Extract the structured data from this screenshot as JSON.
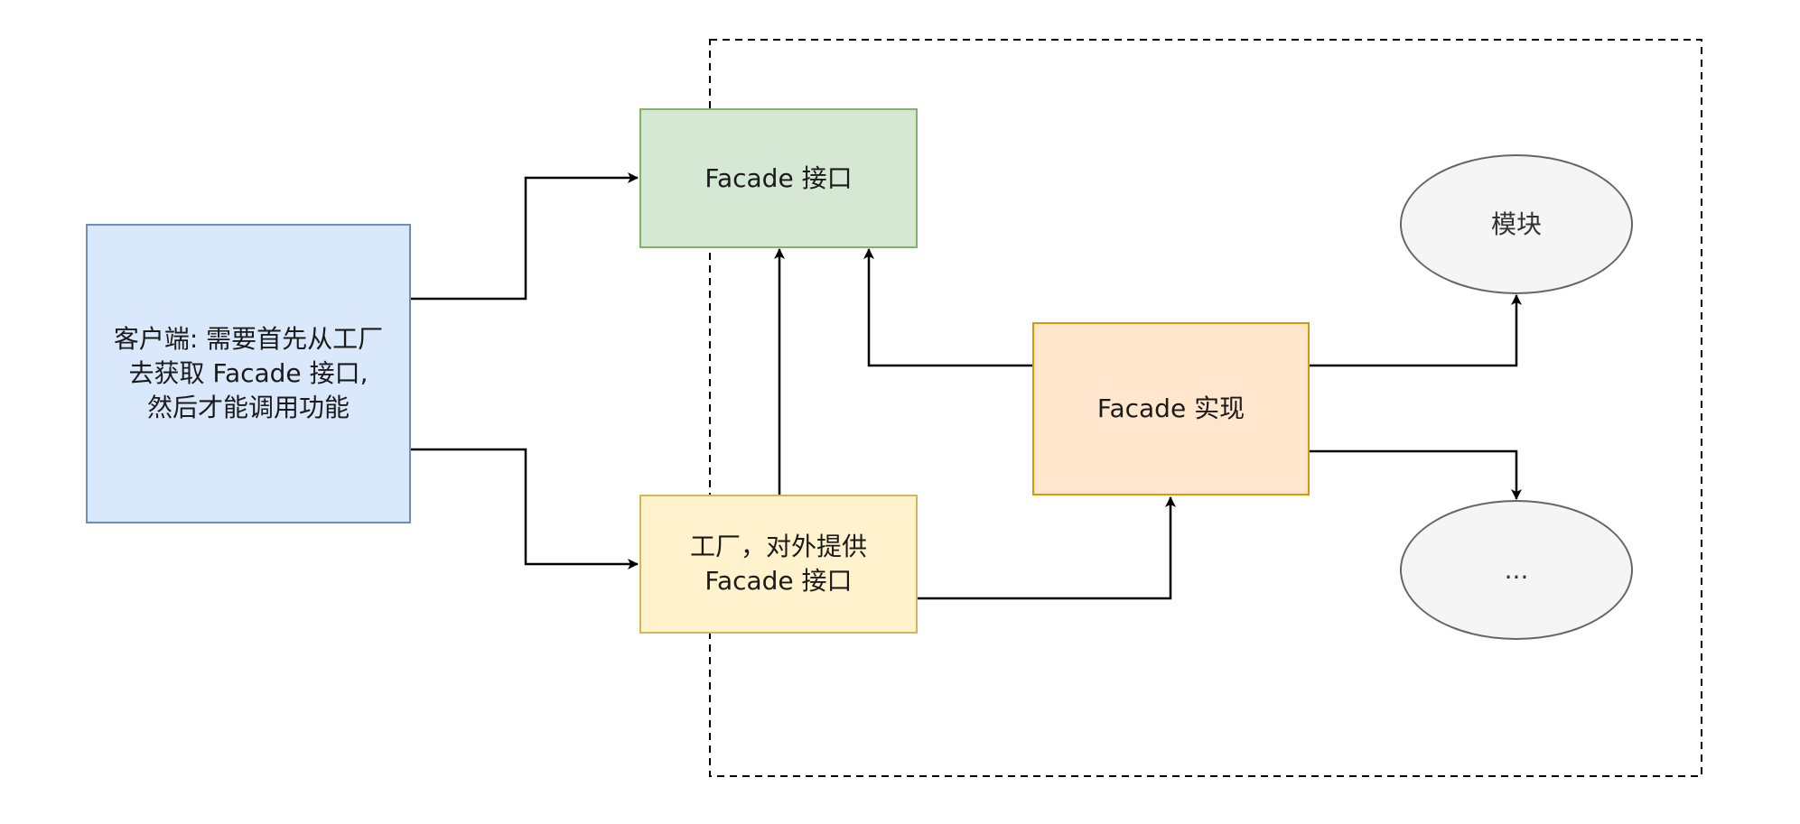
{
  "nodes": {
    "client": {
      "text": "客户端: 需要首先从工厂\n去获取 Facade 接口,\n然后才能调用功能",
      "fill": "#dae8fc",
      "stroke": "#6c8ebf"
    },
    "facade_interface": {
      "text": "Facade 接口",
      "fill": "#d5e8d4",
      "stroke": "#82b366"
    },
    "factory": {
      "text": "工厂，对外提供\nFacade 接口",
      "fill": "#fff2cc",
      "stroke": "#d6b656"
    },
    "facade_impl": {
      "text": "Facade 实现",
      "fill": "#ffe6cc",
      "stroke": "#d79b00"
    },
    "module": {
      "text": "模块",
      "fill": "#f5f5f5",
      "stroke": "#666666"
    },
    "more": {
      "text": "...",
      "fill": "#f5f5f5",
      "stroke": "#666666"
    }
  },
  "edges": [
    {
      "from": "client",
      "to": "facade_interface"
    },
    {
      "from": "client",
      "to": "factory"
    },
    {
      "from": "factory",
      "to": "facade_interface"
    },
    {
      "from": "facade_impl",
      "to": "facade_interface"
    },
    {
      "from": "factory",
      "to": "facade_impl"
    },
    {
      "from": "facade_impl",
      "to": "module"
    },
    {
      "from": "facade_impl",
      "to": "more"
    }
  ]
}
